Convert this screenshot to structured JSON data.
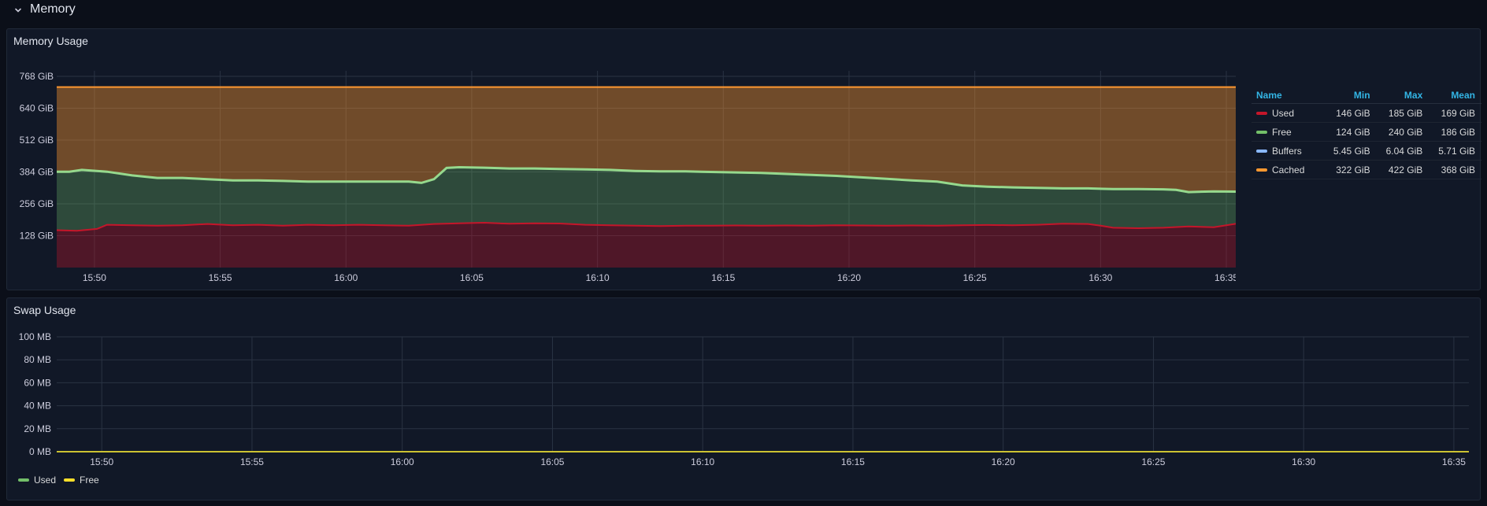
{
  "row": {
    "title": "Memory",
    "chevron_icon": "chevron-down-icon"
  },
  "memory_panel": {
    "title": "Memory Usage",
    "legend": {
      "headers": [
        "Name",
        "Min",
        "Max",
        "Mean"
      ],
      "rows": [
        {
          "name": "Used",
          "min": "146 GiB",
          "max": "185 GiB",
          "mean": "169 GiB",
          "color": "#c4162a"
        },
        {
          "name": "Free",
          "min": "124 GiB",
          "max": "240 GiB",
          "mean": "186 GiB",
          "color": "#73bf69"
        },
        {
          "name": "Buffers",
          "min": "5.45 GiB",
          "max": "6.04 GiB",
          "mean": "5.71 GiB",
          "color": "#8ab8ff"
        },
        {
          "name": "Cached",
          "min": "322 GiB",
          "max": "422 GiB",
          "mean": "368 GiB",
          "color": "#ff9830"
        }
      ]
    }
  },
  "swap_panel": {
    "title": "Swap Usage",
    "legend": [
      {
        "name": "Used",
        "color": "#73bf69"
      },
      {
        "name": "Free",
        "color": "#fade2a"
      }
    ]
  },
  "chart_data": [
    {
      "type": "area",
      "title": "Memory Usage",
      "stacked": true,
      "x_ticks": [
        "15:50",
        "15:55",
        "16:00",
        "16:05",
        "16:10",
        "16:15",
        "16:20",
        "16:25",
        "16:30",
        "16:35"
      ],
      "y_ticks": [
        "128 GiB",
        "256 GiB",
        "384 GiB",
        "512 GiB",
        "640 GiB",
        "768 GiB"
      ],
      "ylim": [
        0,
        790
      ],
      "x_minutes_range": [
        0,
        47
      ],
      "series": [
        {
          "name": "Used",
          "color": "#c4162a",
          "points": [
            [
              0,
              150
            ],
            [
              0.8,
              148
            ],
            [
              1.6,
              155
            ],
            [
              2,
              172
            ],
            [
              3,
              170
            ],
            [
              4,
              168
            ],
            [
              5,
              170
            ],
            [
              6,
              175
            ],
            [
              7,
              170
            ],
            [
              8,
              172
            ],
            [
              9,
              168
            ],
            [
              10,
              172
            ],
            [
              11,
              170
            ],
            [
              12,
              172
            ],
            [
              13,
              170
            ],
            [
              14,
              168
            ],
            [
              15,
              175
            ],
            [
              16,
              178
            ],
            [
              17,
              180
            ],
            [
              18,
              176
            ],
            [
              19,
              178
            ],
            [
              20,
              177
            ],
            [
              21,
              172
            ],
            [
              22,
              170
            ],
            [
              23,
              168
            ],
            [
              24,
              167
            ],
            [
              25,
              168
            ],
            [
              26,
              168
            ],
            [
              27,
              169
            ],
            [
              28,
              168
            ],
            [
              29,
              169
            ],
            [
              30,
              168
            ],
            [
              31,
              170
            ],
            [
              32,
              169
            ],
            [
              33,
              168
            ],
            [
              34,
              169
            ],
            [
              35,
              168
            ],
            [
              36,
              170
            ],
            [
              37,
              171
            ],
            [
              38,
              170
            ],
            [
              39,
              172
            ],
            [
              40,
              176
            ],
            [
              41,
              175
            ],
            [
              41.5,
              168
            ],
            [
              42,
              160
            ],
            [
              43,
              158
            ],
            [
              44,
              160
            ],
            [
              45,
              165
            ],
            [
              46,
              162
            ],
            [
              47,
              178
            ]
          ]
        },
        {
          "name": "Free",
          "color": "#73bf69",
          "points": [
            [
              0,
              385
            ],
            [
              0.5,
              385
            ],
            [
              1,
              392
            ],
            [
              2,
              385
            ],
            [
              3,
              370
            ],
            [
              4,
              360
            ],
            [
              5,
              360
            ],
            [
              6,
              355
            ],
            [
              7,
              350
            ],
            [
              8,
              350
            ],
            [
              9,
              348
            ],
            [
              10,
              345
            ],
            [
              11,
              345
            ],
            [
              12,
              345
            ],
            [
              13,
              345
            ],
            [
              14,
              345
            ],
            [
              14.5,
              340
            ],
            [
              15,
              355
            ],
            [
              15.5,
              400
            ],
            [
              16,
              403
            ],
            [
              17,
              401
            ],
            [
              18,
              398
            ],
            [
              19,
              398
            ],
            [
              20,
              396
            ],
            [
              21,
              394
            ],
            [
              22,
              392
            ],
            [
              23,
              388
            ],
            [
              24,
              386
            ],
            [
              25,
              386
            ],
            [
              26,
              384
            ],
            [
              27,
              382
            ],
            [
              28,
              380
            ],
            [
              29,
              376
            ],
            [
              30,
              372
            ],
            [
              31,
              368
            ],
            [
              32,
              362
            ],
            [
              33,
              356
            ],
            [
              34,
              350
            ],
            [
              35,
              345
            ],
            [
              36,
              330
            ],
            [
              37,
              325
            ],
            [
              38,
              322
            ],
            [
              39,
              320
            ],
            [
              40,
              318
            ],
            [
              41,
              318
            ],
            [
              42,
              315
            ],
            [
              43,
              315
            ],
            [
              44,
              314
            ],
            [
              44.5,
              312
            ],
            [
              45,
              303
            ],
            [
              46,
              306
            ],
            [
              47,
              305
            ]
          ]
        },
        {
          "name": "Buffers",
          "color": "#8ab8ff",
          "points": [
            [
              0,
              6
            ],
            [
              47,
              6
            ]
          ]
        },
        {
          "name": "Cached",
          "color": "#ff9830",
          "points": [
            [
              0,
              725
            ],
            [
              47,
              725
            ]
          ]
        }
      ]
    },
    {
      "type": "line",
      "title": "Swap Usage",
      "x_ticks": [
        "15:50",
        "15:55",
        "16:00",
        "16:05",
        "16:10",
        "16:15",
        "16:20",
        "16:25",
        "16:30",
        "16:35"
      ],
      "y_ticks": [
        "0 MB",
        "20 MB",
        "40 MB",
        "60 MB",
        "80 MB",
        "100 MB"
      ],
      "ylim": [
        0,
        100
      ],
      "series": [
        {
          "name": "Used",
          "color": "#73bf69",
          "values": [
            0,
            0
          ]
        },
        {
          "name": "Free",
          "color": "#fade2a",
          "values": [
            0,
            0
          ]
        }
      ]
    }
  ]
}
